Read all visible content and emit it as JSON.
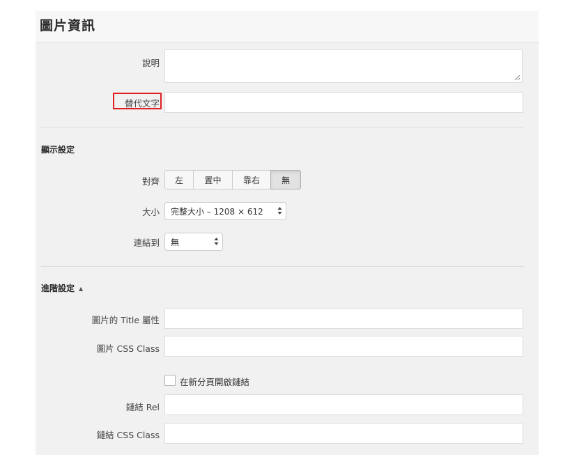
{
  "panel": {
    "title": "圖片資訊"
  },
  "fields": {
    "caption_label": "說明",
    "caption_value": "",
    "alt_label": "替代文字",
    "alt_value": ""
  },
  "display": {
    "section_title": "顯示設定",
    "align_label": "對齊",
    "align_options": [
      "左",
      "置中",
      "靠右",
      "無"
    ],
    "align_selected": "無",
    "size_label": "大小",
    "size_value": "完整大小 – 1208 × 612",
    "link_label": "連結到",
    "link_value": "無"
  },
  "advanced": {
    "section_title": "進階設定",
    "toggle_icon": "triangle-up-icon",
    "title_attr_label": "圖片的 Title 屬性",
    "title_attr_value": "",
    "css_class_label": "圖片 CSS Class",
    "css_class_value": "",
    "new_tab_label": "在新分頁開啟鏈結",
    "new_tab_checked": false,
    "link_rel_label": "鏈結 Rel",
    "link_rel_value": "",
    "link_css_label": "鏈結 CSS Class",
    "link_css_value": ""
  },
  "colors": {
    "highlight": "#e02020",
    "panel_bg": "#f1f1f1",
    "active_button": "#e2e2e2"
  }
}
